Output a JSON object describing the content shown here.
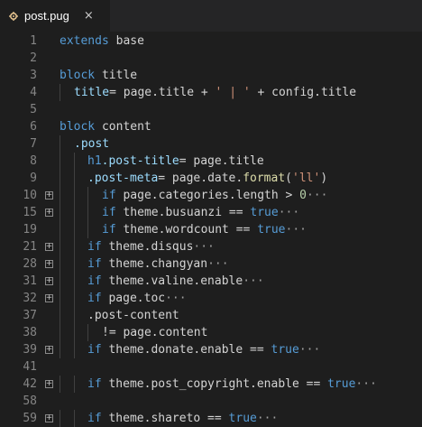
{
  "tab": {
    "filename": "post.pug",
    "close_glyph": "×",
    "icon": "gear-icon",
    "icon_color": "#e2c08d"
  },
  "colors": {
    "keyword": "#569cd6",
    "identifier": "#9cdcfe",
    "string": "#ce9178",
    "number": "#b5cea8",
    "function": "#dcdcaa",
    "plain": "#d4d4d4",
    "line_number": "#858585",
    "background": "#1e1e1e"
  },
  "lines": [
    {
      "num": "1",
      "indent": 0,
      "fold": false,
      "tokens": [
        [
          "kw",
          "extends"
        ],
        [
          "txt",
          " base"
        ]
      ]
    },
    {
      "num": "2",
      "indent": 0,
      "fold": false,
      "tokens": []
    },
    {
      "num": "3",
      "indent": 0,
      "fold": false,
      "tokens": [
        [
          "kw",
          "block"
        ],
        [
          "txt",
          " title"
        ]
      ]
    },
    {
      "num": "4",
      "indent": 1,
      "fold": false,
      "tokens": [
        [
          "id",
          "title"
        ],
        [
          "txt",
          "= page.title + "
        ],
        [
          "str",
          "' | '"
        ],
        [
          "txt",
          " + config.title"
        ]
      ]
    },
    {
      "num": "5",
      "indent": 0,
      "fold": false,
      "tokens": []
    },
    {
      "num": "6",
      "indent": 0,
      "fold": false,
      "tokens": [
        [
          "kw",
          "block"
        ],
        [
          "txt",
          " content"
        ]
      ]
    },
    {
      "num": "7",
      "indent": 1,
      "fold": false,
      "tokens": [
        [
          "id",
          ".post"
        ]
      ]
    },
    {
      "num": "8",
      "indent": 2,
      "fold": false,
      "tokens": [
        [
          "kw",
          "h1"
        ],
        [
          "id",
          ".post-title"
        ],
        [
          "txt",
          "= page.title"
        ]
      ]
    },
    {
      "num": "9",
      "indent": 2,
      "fold": false,
      "tokens": [
        [
          "id",
          ".post-meta"
        ],
        [
          "txt",
          "= page.date."
        ],
        [
          "fn",
          "format"
        ],
        [
          "txt",
          "("
        ],
        [
          "str",
          "'ll'"
        ],
        [
          "txt",
          ")"
        ]
      ]
    },
    {
      "num": "10",
      "indent": 3,
      "fold": true,
      "tokens": [
        [
          "kw",
          "if"
        ],
        [
          "txt",
          " page.categories.length > "
        ],
        [
          "num",
          "0"
        ],
        [
          "ell",
          "···"
        ]
      ]
    },
    {
      "num": "15",
      "indent": 3,
      "fold": true,
      "tokens": [
        [
          "kw",
          "if"
        ],
        [
          "txt",
          " theme.busuanzi == "
        ],
        [
          "kw",
          "true"
        ],
        [
          "ell",
          "···"
        ]
      ]
    },
    {
      "num": "19",
      "indent": 3,
      "fold": false,
      "tokens": [
        [
          "kw",
          "if"
        ],
        [
          "txt",
          " theme.wordcount == "
        ],
        [
          "kw",
          "true"
        ],
        [
          "ell",
          "···"
        ]
      ]
    },
    {
      "num": "21",
      "indent": 2,
      "fold": true,
      "tokens": [
        [
          "kw",
          "if"
        ],
        [
          "txt",
          " theme.disqus"
        ],
        [
          "ell",
          "···"
        ]
      ]
    },
    {
      "num": "28",
      "indent": 2,
      "fold": true,
      "tokens": [
        [
          "kw",
          "if"
        ],
        [
          "txt",
          " theme.changyan"
        ],
        [
          "ell",
          "···"
        ]
      ]
    },
    {
      "num": "31",
      "indent": 2,
      "fold": true,
      "tokens": [
        [
          "kw",
          "if"
        ],
        [
          "txt",
          " theme.valine.enable"
        ],
        [
          "ell",
          "···"
        ]
      ]
    },
    {
      "num": "32",
      "indent": 2,
      "fold": true,
      "tokens": [
        [
          "kw",
          "if"
        ],
        [
          "txt",
          " page.toc"
        ],
        [
          "ell",
          "···"
        ]
      ]
    },
    {
      "num": "37",
      "indent": 2,
      "fold": false,
      "tokens": [
        [
          "txt",
          ".post-content"
        ]
      ]
    },
    {
      "num": "38",
      "indent": 3,
      "fold": false,
      "tokens": [
        [
          "txt",
          "!= page.content"
        ]
      ]
    },
    {
      "num": "39",
      "indent": 2,
      "fold": true,
      "tokens": [
        [
          "kw",
          "if"
        ],
        [
          "txt",
          " theme.donate.enable == "
        ],
        [
          "kw",
          "true"
        ],
        [
          "ell",
          "···"
        ]
      ]
    },
    {
      "num": "41",
      "indent": 0,
      "fold": false,
      "tokens": []
    },
    {
      "num": "42",
      "indent": 2,
      "fold": true,
      "tokens": [
        [
          "kw",
          "if"
        ],
        [
          "txt",
          " theme.post_copyright.enable == "
        ],
        [
          "kw",
          "true"
        ],
        [
          "ell",
          "···"
        ]
      ]
    },
    {
      "num": "58",
      "indent": 0,
      "fold": false,
      "tokens": []
    },
    {
      "num": "59",
      "indent": 2,
      "fold": true,
      "tokens": [
        [
          "kw",
          "if"
        ],
        [
          "txt",
          " theme.shareto == "
        ],
        [
          "kw",
          "true"
        ],
        [
          "ell",
          "···"
        ]
      ]
    }
  ]
}
